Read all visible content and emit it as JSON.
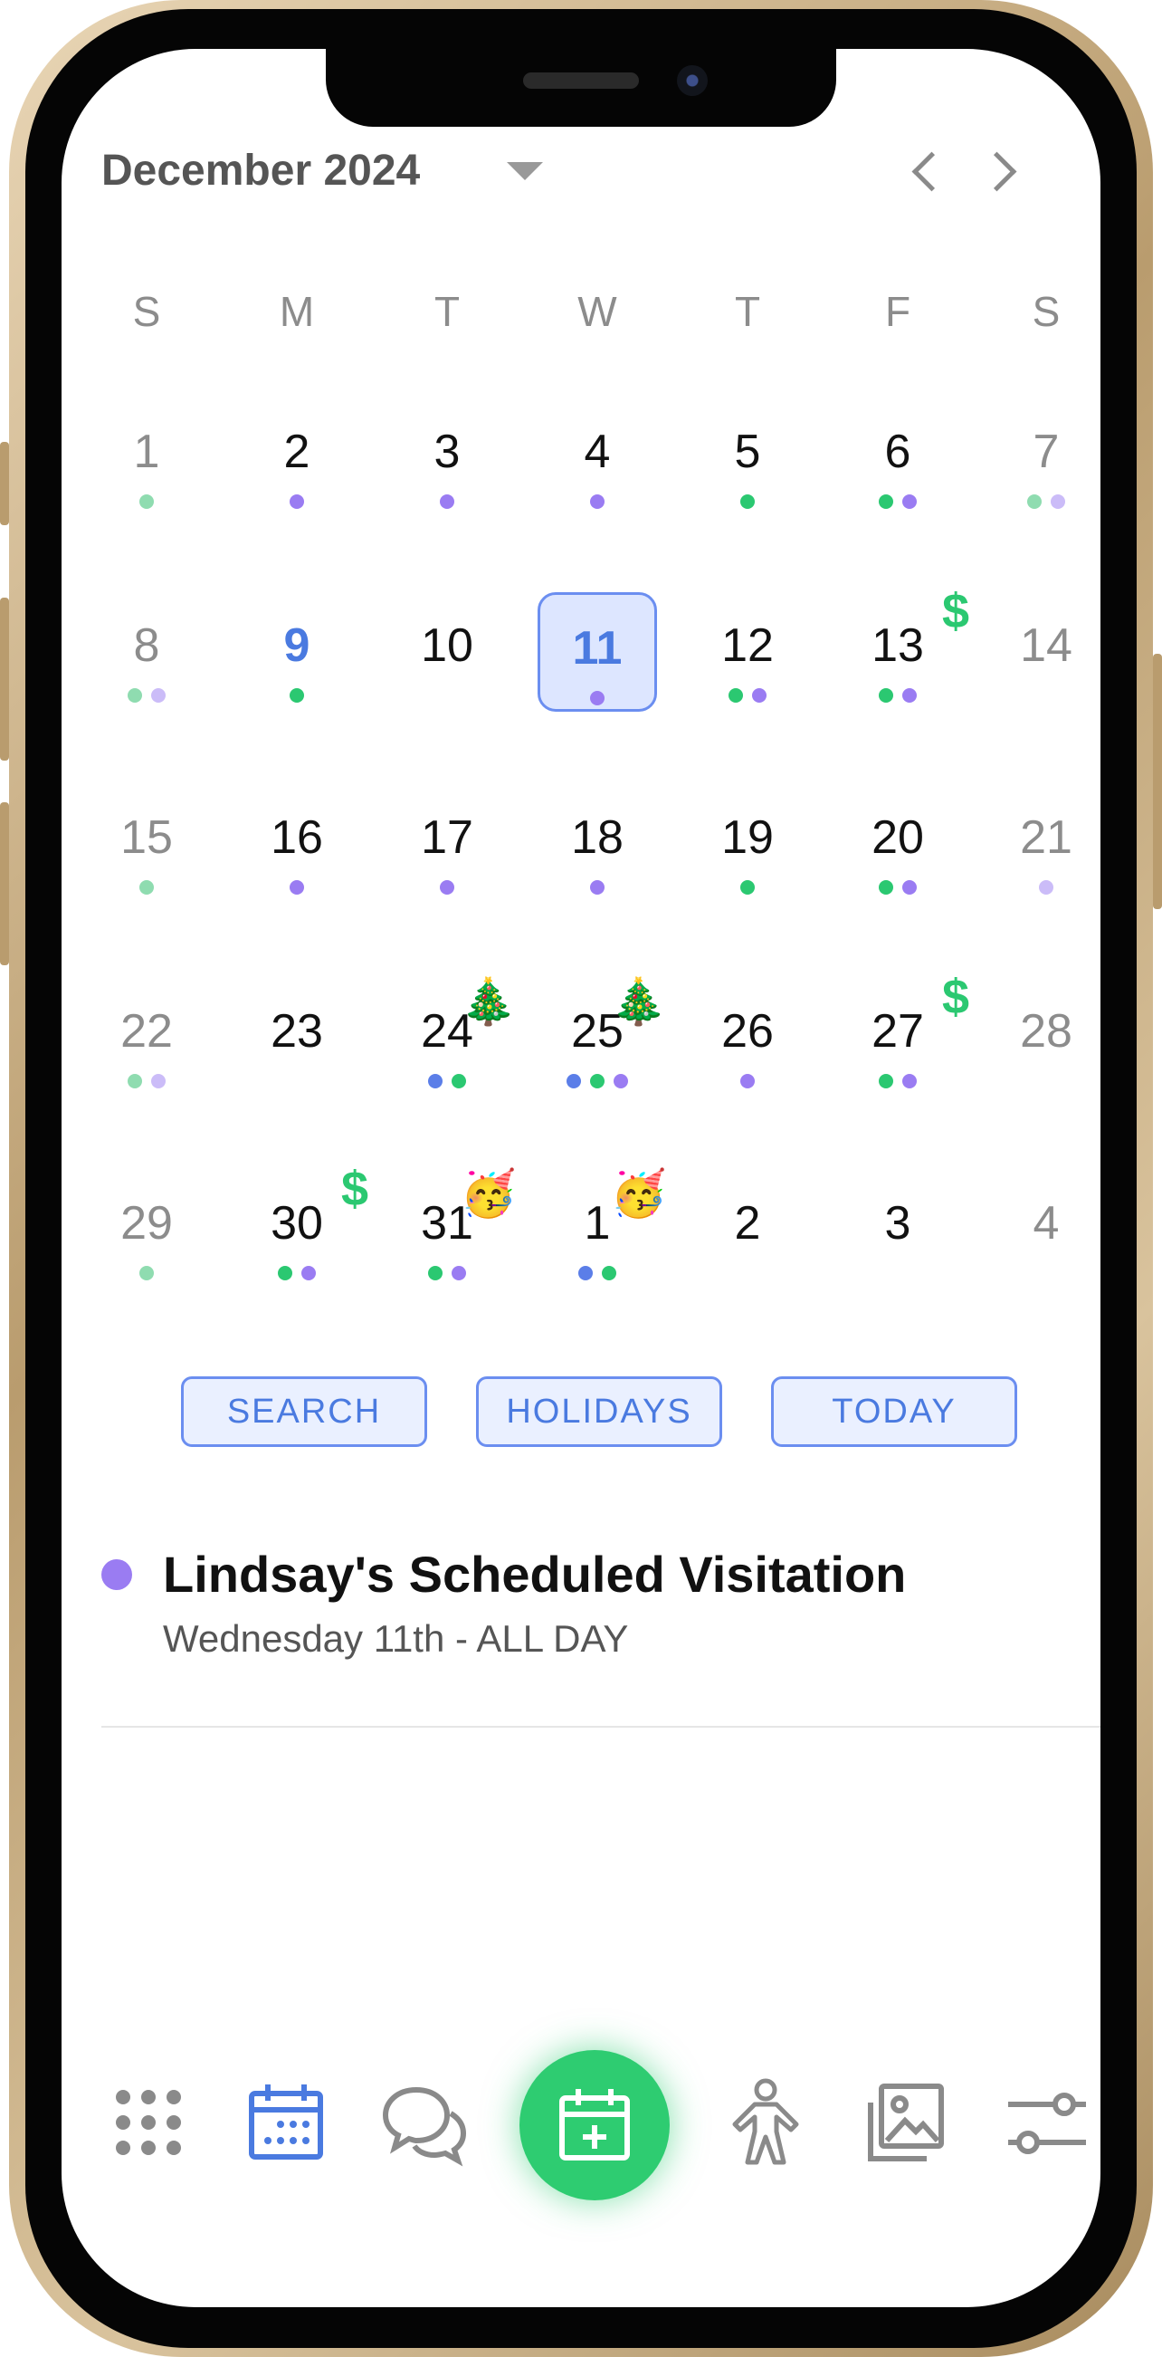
{
  "calendar": {
    "month_label": "December 2024",
    "weekdays": [
      "S",
      "M",
      "T",
      "W",
      "T",
      "F",
      "S"
    ],
    "weeks": [
      [
        {
          "d": "1",
          "w": 1,
          "dots": [
            "lgreen"
          ]
        },
        {
          "d": "2",
          "dots": [
            "purple"
          ]
        },
        {
          "d": "3",
          "dots": [
            "purple"
          ]
        },
        {
          "d": "4",
          "dots": [
            "purple"
          ]
        },
        {
          "d": "5",
          "dots": [
            "green"
          ]
        },
        {
          "d": "6",
          "dots": [
            "green",
            "purple"
          ]
        },
        {
          "d": "7",
          "w": 1,
          "dots": [
            "lgreen",
            "lpurple"
          ]
        }
      ],
      [
        {
          "d": "8",
          "w": 1,
          "dots": [
            "lgreen",
            "lpurple"
          ]
        },
        {
          "d": "9",
          "today": 1,
          "dots": [
            "green"
          ]
        },
        {
          "d": "10",
          "dots": []
        },
        {
          "d": "11",
          "sel": 1,
          "dots": [
            "purple"
          ]
        },
        {
          "d": "12",
          "dots": [
            "green",
            "purple"
          ]
        },
        {
          "d": "13",
          "dots": [
            "green",
            "purple"
          ],
          "badge": "$"
        },
        {
          "d": "14",
          "w": 1,
          "dots": []
        }
      ],
      [
        {
          "d": "15",
          "w": 1,
          "dots": [
            "lgreen"
          ]
        },
        {
          "d": "16",
          "dots": [
            "purple"
          ]
        },
        {
          "d": "17",
          "dots": [
            "purple"
          ]
        },
        {
          "d": "18",
          "dots": [
            "purple"
          ]
        },
        {
          "d": "19",
          "dots": [
            "green"
          ]
        },
        {
          "d": "20",
          "dots": [
            "green",
            "purple"
          ]
        },
        {
          "d": "21",
          "w": 1,
          "dots": [
            "lpurple"
          ]
        }
      ],
      [
        {
          "d": "22",
          "w": 1,
          "dots": [
            "lgreen",
            "lpurple"
          ]
        },
        {
          "d": "23",
          "dots": []
        },
        {
          "d": "24",
          "dots": [
            "blue",
            "green"
          ],
          "badge": "🎄"
        },
        {
          "d": "25",
          "dots": [
            "blue",
            "green",
            "purple"
          ],
          "badge": "🎄"
        },
        {
          "d": "26",
          "dots": [
            "purple"
          ]
        },
        {
          "d": "27",
          "dots": [
            "green",
            "purple"
          ],
          "badge": "$"
        },
        {
          "d": "28",
          "w": 1,
          "dots": []
        }
      ],
      [
        {
          "d": "29",
          "w": 1,
          "dots": [
            "lgreen"
          ]
        },
        {
          "d": "30",
          "dots": [
            "green",
            "purple"
          ],
          "badge": "$"
        },
        {
          "d": "31",
          "dots": [
            "green",
            "purple"
          ],
          "badge": "🥳"
        },
        {
          "d": "1",
          "dots": [
            "blue",
            "green"
          ],
          "badge": "🥳"
        },
        {
          "d": "2",
          "dots": []
        },
        {
          "d": "3",
          "dots": []
        },
        {
          "d": "4",
          "w": 1,
          "dots": []
        }
      ]
    ]
  },
  "actions": {
    "search": "SEARCH",
    "holidays": "HOLIDAYS",
    "today": "TODAY"
  },
  "event": {
    "title": "Lindsay's Scheduled Visitation",
    "subtitle": "Wednesday 11th - ALL DAY"
  },
  "colors": {
    "green": "#2bc871",
    "lgreen": "#8fdcb0",
    "purple": "#9a7cf2",
    "lpurple": "#cbbcf8",
    "blue": "#5b7ee8",
    "accent": "#4a7ae0",
    "fab": "#2ecc71",
    "event_dot": "#9a7cf2"
  },
  "tabbar": {
    "icons": [
      "grid-icon",
      "calendar-icon",
      "chat-bubbles-icon",
      "add-event-icon",
      "person-icon",
      "photos-icon",
      "sliders-icon"
    ]
  }
}
